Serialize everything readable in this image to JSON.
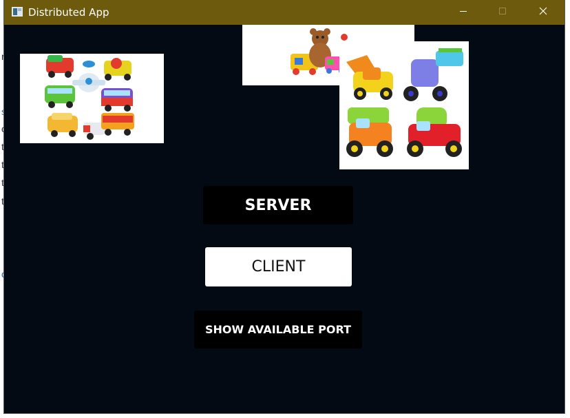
{
  "window": {
    "title": "Distributed App",
    "controls": {
      "minimize_icon": "minimize-icon",
      "maximize_icon": "maximize-icon",
      "close_icon": "close-icon"
    },
    "titlebar_color": "#6d5a0c",
    "background_color": "#030a13"
  },
  "background_app": {
    "snippets": [
      "r",
      "s",
      "c",
      "t",
      "t",
      "t",
      "t",
      "c"
    ]
  },
  "images": {
    "left": "toy vehicles collage",
    "middle": "teddy bear with toy truck",
    "right": "toy construction trucks"
  },
  "buttons": {
    "server": "SERVER",
    "client": "CLIENT",
    "show_port": "SHOW AVAILABLE PORT"
  }
}
